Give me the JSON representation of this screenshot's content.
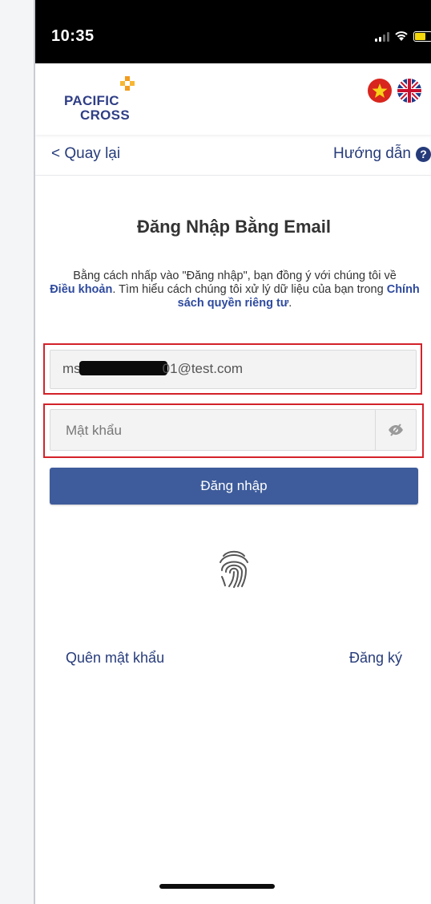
{
  "status_bar": {
    "time": "10:35"
  },
  "header": {
    "logo_line1": "PACIFIC",
    "logo_line2": "CROSS",
    "languages": [
      "vietnamese-flag-icon",
      "uk-flag-icon"
    ]
  },
  "nav": {
    "back_label": "< Quay lại",
    "help_label": "Hướng dẫn",
    "help_icon": "?"
  },
  "login": {
    "title": "Đăng Nhập Bằng Email",
    "terms_part1": "Bằng cách nhấp vào \"Đăng nhập\", bạn đồng ý với chúng tôi về",
    "terms_link": "Điều khoản",
    "terms_part2": ". Tìm hiểu cách chúng tôi xử lý dữ liệu của bạn trong",
    "privacy_link": "Chính sách quyền riêng tư",
    "terms_part3": ".",
    "email_prefix": "ms",
    "email_suffix": "01@test.com",
    "password_placeholder": "Mật khẩu",
    "login_button": "Đăng nhập"
  },
  "footer_links": {
    "forgot": "Quên mật khẩu",
    "register": "Đăng ký"
  },
  "colors": {
    "brand": "#2f3e86",
    "button": "#3e5c9b",
    "highlight": "#d3222a"
  }
}
